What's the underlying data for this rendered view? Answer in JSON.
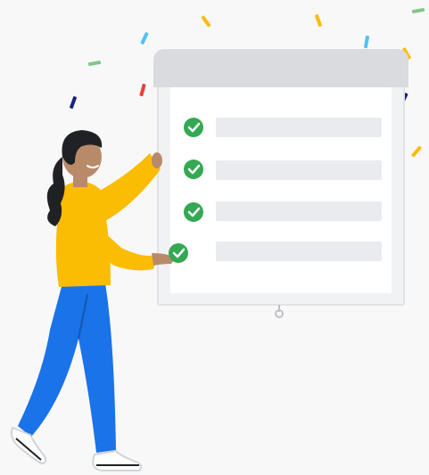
{
  "illustration": {
    "subject": "checklist-celebration",
    "icons": [
      "check-icon",
      "confetti-icon",
      "person-icon",
      "board-icon"
    ],
    "colors": {
      "background": "#f8f8f9",
      "board": "#f1f2f4",
      "board_header": "#d9dbde",
      "line_placeholder": "#e9ebee",
      "check": "#34a853",
      "shirt": "#fbbc04",
      "pants": "#1a73e8",
      "hair": "#202124",
      "skin": "#b98a6a",
      "shoes": "#ffffff"
    },
    "checklist": {
      "rows": [
        {
          "checked": true
        },
        {
          "checked": true
        },
        {
          "checked": true
        },
        {
          "checked": false
        }
      ]
    }
  }
}
